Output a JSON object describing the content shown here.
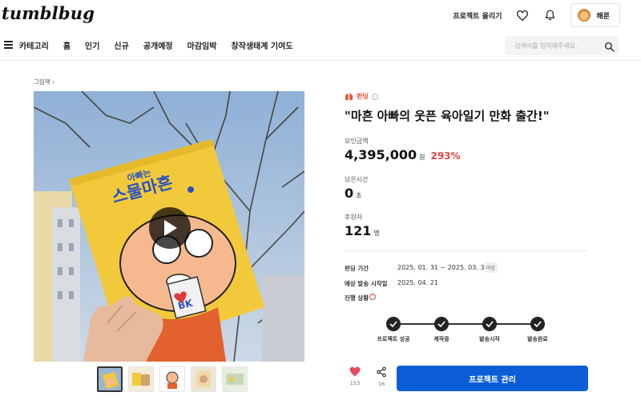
{
  "header": {
    "logo": "tumblbug",
    "project_upload": "프로젝트 올리기",
    "user_name": "해룬"
  },
  "nav": {
    "items": [
      "카테고리",
      "홈",
      "인기",
      "신규",
      "공개예정",
      "마감임박",
      "창작생태계 기여도"
    ],
    "search_placeholder": "검색어를 입력해주세요."
  },
  "breadcrumb": "그림책 ›",
  "project": {
    "category": "펀딩",
    "title": "\"마흔 아빠의 웃픈 육아일기 만화 출간!\"",
    "cover_book_title": "스물마흔",
    "cover_badge": "BK"
  },
  "stats": {
    "amount_label": "모인금액",
    "amount": "4,395,000",
    "amount_unit": "원",
    "percent": "293%",
    "time_label": "남은시간",
    "time_value": "0",
    "time_unit": "초",
    "backers_label": "후원자",
    "backers": "121",
    "backers_unit": "명"
  },
  "details": {
    "funding_period_label": "펀딩 기간",
    "funding_period": "2025. 01. 31 ~ 2025. 03. 31",
    "deadline_badge": "마감",
    "shipping_label": "예상 발송 시작일",
    "shipping_date": "2025. 04. 21",
    "progress_label": "진행 상황"
  },
  "progress_steps": [
    "프로젝트 성공",
    "제작중",
    "발송시작",
    "발송완료"
  ],
  "actions": {
    "likes": "153",
    "shares": "16",
    "manage_label": "프로젝트 관리"
  },
  "colors": {
    "accent_blue": "#0b5ed7",
    "percent_red": "#e44747",
    "category_orange": "#e8542e"
  },
  "icons": {
    "heart": "heart-icon",
    "bell": "bell-icon",
    "menu": "menu-icon",
    "search": "search-icon",
    "play": "play-icon",
    "like": "heart-filled-icon",
    "share": "share-icon",
    "check": "check-icon"
  }
}
